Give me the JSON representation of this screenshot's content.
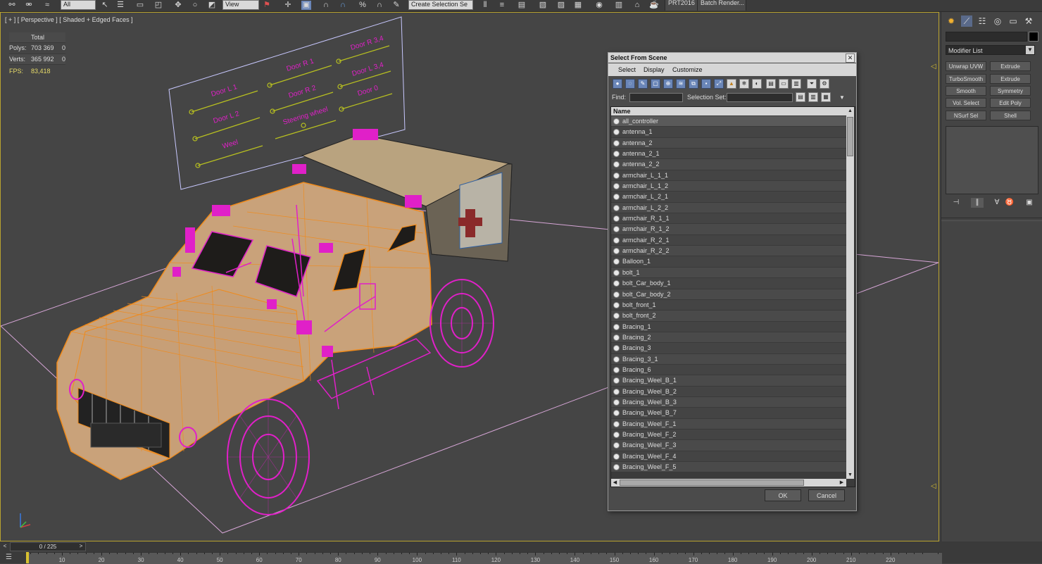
{
  "toolbar": {
    "filter_value": "All",
    "view_value": "View",
    "selection_set_placeholder": "Create Selection Se",
    "prt_label": "PRT2016",
    "batch_render_label": "Batch Render..."
  },
  "viewport": {
    "label": "[ + ] [ Perspective ] [ Shaded + Edged Faces ]",
    "stats": {
      "header": "Total",
      "polys_label": "Polys:",
      "polys_total": "703 369",
      "polys_sel": "0",
      "verts_label": "Verts:",
      "verts_total": "365 992",
      "verts_sel": "0",
      "fps_label": "FPS:",
      "fps_value": "83,418"
    },
    "controller_labels": [
      "Door L 1",
      "Door R 1",
      "Door R 3,4",
      "Door L 2",
      "Door R 2",
      "Door L 3,4",
      "Weel",
      "Steering wheel",
      "Door 0"
    ],
    "wire_color": "#e020c8",
    "edge_color": "#f08a1a"
  },
  "right_panel": {
    "modifier_list_label": "Modifier List",
    "modifiers": [
      "Unwrap UVW",
      "Extrude",
      "TurboSmooth",
      "Extrude",
      "Smooth",
      "Symmetry",
      "Vol. Select",
      "Edit Poly",
      "NSurf Sel",
      "Shell"
    ]
  },
  "dialog": {
    "title": "Select From Scene",
    "menu": [
      "Select",
      "Display",
      "Customize"
    ],
    "find_label": "Find:",
    "selection_set_label": "Selection Set:",
    "column_name": "Name",
    "items": [
      "all_controller",
      "antenna_1",
      "antenna_2",
      "antenna_2_1",
      "antenna_2_2",
      "armchair_L_1_1",
      "armchair_L_1_2",
      "armchair_L_2_1",
      "armchair_L_2_2",
      "armchair_R_1_1",
      "armchair_R_1_2",
      "armchair_R_2_1",
      "armchair_R_2_2",
      "Balloon_1",
      "bolt_1",
      "bolt_Car_body_1",
      "bolt_Car_body_2",
      "bolt_front_1",
      "bolt_front_2",
      "Bracing_1",
      "Bracing_2",
      "Bracing_3",
      "Bracing_3_1",
      "Bracing_6",
      "Bracing_Weel_B_1",
      "Bracing_Weel_B_2",
      "Bracing_Weel_B_3",
      "Bracing_Weel_B_7",
      "Bracing_Weel_F_1",
      "Bracing_Weel_F_2",
      "Bracing_Weel_F_3",
      "Bracing_Weel_F_4",
      "Bracing_Weel_F_5"
    ],
    "ok_label": "OK",
    "cancel_label": "Cancel"
  },
  "timeline": {
    "frame_display": "0 / 225",
    "ticks": [
      "10",
      "20",
      "30",
      "40",
      "50",
      "60",
      "70",
      "80",
      "90",
      "100",
      "110",
      "120",
      "130",
      "140",
      "150",
      "160",
      "170",
      "180",
      "190",
      "200",
      "210",
      "220"
    ]
  }
}
